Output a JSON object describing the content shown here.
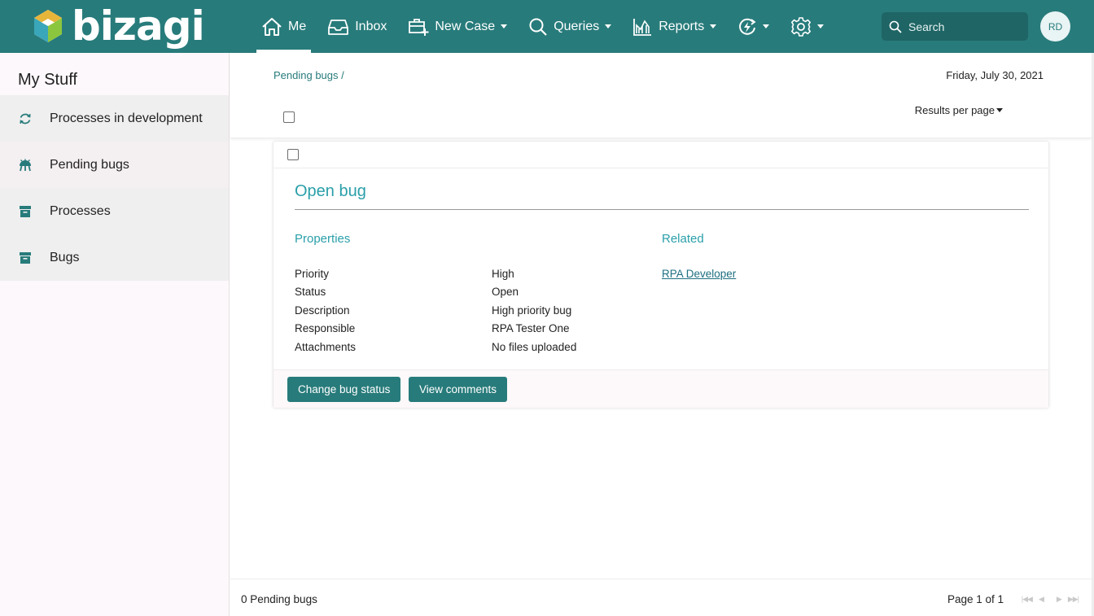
{
  "brand": {
    "name": "bizagi"
  },
  "nav": {
    "items": [
      {
        "label": "Me",
        "icon": "home-icon",
        "active": true,
        "dropdown": false
      },
      {
        "label": "Inbox",
        "icon": "inbox-icon",
        "active": false,
        "dropdown": false
      },
      {
        "label": "New Case",
        "icon": "new-case-icon",
        "active": false,
        "dropdown": true
      },
      {
        "label": "Queries",
        "icon": "search-icon",
        "active": false,
        "dropdown": true
      },
      {
        "label": "Reports",
        "icon": "chart-icon",
        "active": false,
        "dropdown": true
      },
      {
        "label": "",
        "icon": "activity-icon",
        "active": false,
        "dropdown": true
      },
      {
        "label": "",
        "icon": "gear-icon",
        "active": false,
        "dropdown": true
      }
    ]
  },
  "search": {
    "placeholder": "Search"
  },
  "user": {
    "initials": "RD"
  },
  "sidebar": {
    "title": "My Stuff",
    "items": [
      {
        "label": "Processes in development",
        "icon": "refresh-icon"
      },
      {
        "label": "Pending bugs",
        "icon": "bug-icon"
      },
      {
        "label": "Processes",
        "icon": "archive-icon"
      },
      {
        "label": "Bugs",
        "icon": "archive-icon"
      }
    ]
  },
  "header": {
    "breadcrumb": "Pending bugs /",
    "date": "Friday, July 30, 2021",
    "results_label": "Results per page"
  },
  "card": {
    "title": "Open bug",
    "properties_heading": "Properties",
    "related_heading": "Related",
    "properties": [
      {
        "label": "Priority",
        "value": "High"
      },
      {
        "label": "Status",
        "value": "Open"
      },
      {
        "label": "Description",
        "value": "High priority bug"
      },
      {
        "label": "Responsible",
        "value": "RPA Tester One"
      },
      {
        "label": "Attachments",
        "value": "No files uploaded"
      }
    ],
    "related_link": "RPA Developer",
    "buttons": {
      "change_status": "Change bug status",
      "view_comments": "View comments"
    }
  },
  "footer": {
    "count": "0 Pending bugs",
    "page": "Page 1 of 1"
  },
  "colors": {
    "brand": "#287b7b",
    "accent": "#2a9fa9"
  }
}
